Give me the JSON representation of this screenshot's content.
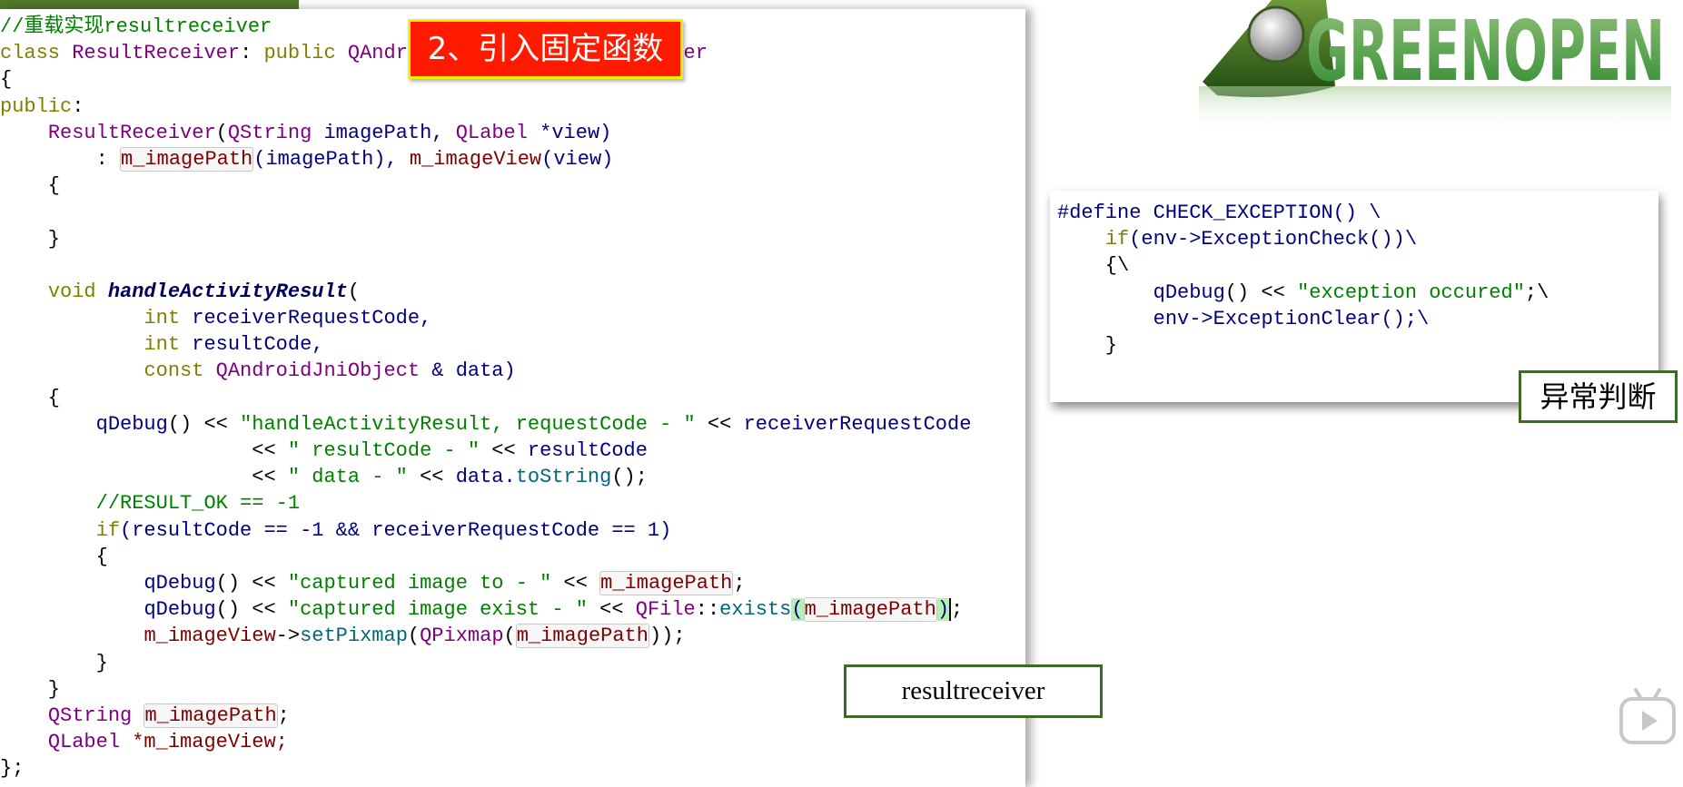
{
  "step_label": "2、引入固定函数",
  "logo": {
    "text": "GREENOPEN"
  },
  "code_lines": [
    [
      [
        "//重载实现resultreceiver",
        "cm"
      ]
    ],
    [
      [
        "class ",
        "kw"
      ],
      [
        "ResultReceiver",
        "ty"
      ],
      [
        ": ",
        "pl"
      ],
      [
        "public ",
        "kw"
      ],
      [
        "QAndroidActivityResultReceiver",
        "ty"
      ]
    ],
    [
      [
        "{",
        "pl"
      ]
    ],
    [
      [
        "public",
        "kw"
      ],
      [
        ":",
        "pl"
      ]
    ],
    [
      [
        "    ",
        "pl"
      ],
      [
        "ResultReceiver",
        "ty"
      ],
      [
        "(",
        "pl"
      ],
      [
        "QString ",
        "ty"
      ],
      [
        "imagePath, ",
        "id"
      ],
      [
        "QLabel ",
        "ty"
      ],
      [
        "*view)",
        "id"
      ]
    ],
    [
      [
        "        : ",
        "pl"
      ],
      [
        "m_imagePath",
        "mv hl"
      ],
      [
        "(imagePath), ",
        "id"
      ],
      [
        "m_imageView",
        "mv"
      ],
      [
        "(view)",
        "id"
      ]
    ],
    [
      [
        "    {",
        "pl"
      ]
    ],
    [
      [
        "",
        "pl"
      ]
    ],
    [
      [
        "    }",
        "pl"
      ]
    ],
    [
      [
        "",
        "pl"
      ]
    ],
    [
      [
        "    ",
        "pl"
      ],
      [
        "void ",
        "kw"
      ],
      [
        "handleActivityResult",
        "fd"
      ],
      [
        "(",
        "pl"
      ]
    ],
    [
      [
        "            ",
        "pl"
      ],
      [
        "int ",
        "kw"
      ],
      [
        "receiverRequestCode,",
        "id"
      ]
    ],
    [
      [
        "            ",
        "pl"
      ],
      [
        "int ",
        "kw"
      ],
      [
        "resultCode,",
        "id"
      ]
    ],
    [
      [
        "            ",
        "pl"
      ],
      [
        "const ",
        "kw"
      ],
      [
        "QAndroidJniObject ",
        "ty"
      ],
      [
        "& data)",
        "id"
      ]
    ],
    [
      [
        "    {",
        "pl"
      ]
    ],
    [
      [
        "        ",
        "pl"
      ],
      [
        "qDebug",
        "id"
      ],
      [
        "() << ",
        "pl"
      ],
      [
        "\"handleActivityResult, requestCode - \"",
        "st"
      ],
      [
        " << ",
        "pl"
      ],
      [
        "receiverRequestCode",
        "id"
      ]
    ],
    [
      [
        "                     << ",
        "pl"
      ],
      [
        "\" resultCode - \"",
        "st"
      ],
      [
        " << ",
        "pl"
      ],
      [
        "resultCode",
        "id"
      ]
    ],
    [
      [
        "                     << ",
        "pl"
      ],
      [
        "\" data - \"",
        "st"
      ],
      [
        " << ",
        "pl"
      ],
      [
        "data.",
        "id"
      ],
      [
        "toString",
        "fn"
      ],
      [
        "();",
        "pl"
      ]
    ],
    [
      [
        "        ",
        "pl"
      ],
      [
        "//RESULT_OK == -1",
        "cm"
      ]
    ],
    [
      [
        "        ",
        "pl"
      ],
      [
        "if",
        "kw"
      ],
      [
        "(resultCode == -1 && receiverRequestCode == 1)",
        "id"
      ]
    ],
    [
      [
        "        {",
        "pl"
      ]
    ],
    [
      [
        "            ",
        "pl"
      ],
      [
        "qDebug",
        "id"
      ],
      [
        "() << ",
        "pl"
      ],
      [
        "\"captured image to - \"",
        "st"
      ],
      [
        " << ",
        "pl"
      ],
      [
        "m_imagePath",
        "mv hl"
      ],
      [
        ";",
        "pl"
      ]
    ],
    [
      [
        "            ",
        "pl"
      ],
      [
        "qDebug",
        "id"
      ],
      [
        "() << ",
        "pl"
      ],
      [
        "\"captured image exist - \"",
        "st"
      ],
      [
        " << ",
        "pl"
      ],
      [
        "QFile",
        "ty"
      ],
      [
        "::",
        "pl"
      ],
      [
        "exists",
        "fn"
      ],
      [
        "(",
        "mp"
      ],
      [
        "m_imagePath",
        "mv hl"
      ],
      [
        ")",
        "mp cursor"
      ],
      [
        ";",
        "pl"
      ]
    ],
    [
      [
        "            ",
        "pl"
      ],
      [
        "m_imageView",
        "mv"
      ],
      [
        "->",
        "pl"
      ],
      [
        "setPixmap",
        "fn"
      ],
      [
        "(",
        "pl"
      ],
      [
        "QPixmap",
        "ty"
      ],
      [
        "(",
        "pl"
      ],
      [
        "m_imagePath",
        "mv hl"
      ],
      [
        "));",
        "pl"
      ]
    ],
    [
      [
        "        }",
        "pl"
      ]
    ],
    [
      [
        "    }",
        "pl"
      ]
    ],
    [
      [
        "    ",
        "pl"
      ],
      [
        "QString ",
        "ty"
      ],
      [
        "m_imagePath",
        "mv hl"
      ],
      [
        ";",
        "pl"
      ]
    ],
    [
      [
        "    ",
        "pl"
      ],
      [
        "QLabel ",
        "ty"
      ],
      [
        "*m_imageView;",
        "mv"
      ]
    ],
    [
      [
        "};",
        "pl"
      ]
    ]
  ],
  "exception_lines": [
    [
      [
        "#define ",
        "pp"
      ],
      [
        "CHECK_EXCEPTION() \\",
        "id"
      ]
    ],
    [
      [
        "    ",
        "pl"
      ],
      [
        "if",
        "kw"
      ],
      [
        "(env->ExceptionCheck())\\",
        "id"
      ]
    ],
    [
      [
        "    {\\",
        "pl"
      ]
    ],
    [
      [
        "        ",
        "pl"
      ],
      [
        "qDebug",
        "id"
      ],
      [
        "() << ",
        "pl"
      ],
      [
        "\"exception occured\"",
        "st"
      ],
      [
        ";\\",
        "pl"
      ]
    ],
    [
      [
        "        ",
        "pl"
      ],
      [
        "env->ExceptionClear();\\",
        "id"
      ]
    ],
    [
      [
        "    }",
        "pl"
      ]
    ]
  ],
  "notes": {
    "exception": "异常判断",
    "resultreceiver": "resultreceiver"
  }
}
